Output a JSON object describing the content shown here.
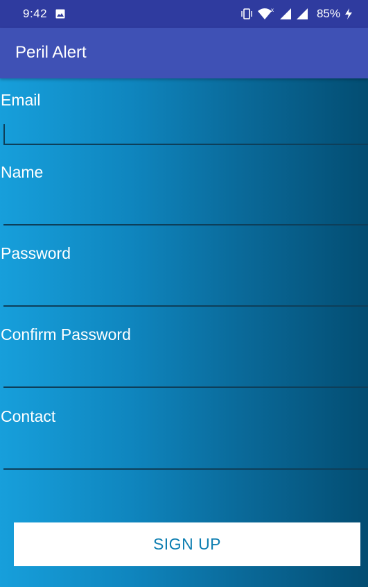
{
  "status_bar": {
    "time": "9:42",
    "battery_percent": "85%",
    "icons": [
      "image-icon",
      "vibrate-icon",
      "wifi-icon",
      "signal-icon",
      "signal-icon",
      "charging-icon"
    ]
  },
  "app_bar": {
    "title": "Peril Alert",
    "color": "#3f51b5"
  },
  "form": {
    "fields": [
      {
        "label": "Email",
        "value": ""
      },
      {
        "label": "Name",
        "value": ""
      },
      {
        "label": "Password",
        "value": ""
      },
      {
        "label": "Confirm Password",
        "value": ""
      },
      {
        "label": "Contact",
        "value": ""
      }
    ],
    "submit_label": "SIGN UP"
  },
  "colors": {
    "status_bar": "#2f3b9f",
    "background_start": "#179fdb",
    "background_end": "#034d72",
    "button_text": "#0f7fb2"
  }
}
